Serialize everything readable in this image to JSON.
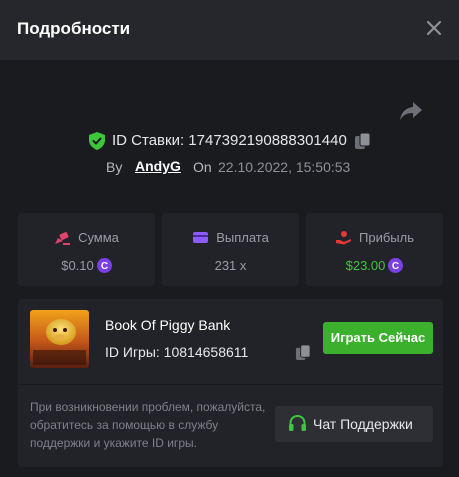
{
  "header": {
    "title": "Подробности",
    "close_icon": "close-icon"
  },
  "bet": {
    "id_label": "ID Ставки: 1747392190888301440",
    "by_label": "By",
    "user": "AndyG",
    "on_label": "On",
    "date": "22.10.2022, 15:50:53"
  },
  "stats": [
    {
      "label": "Сумма",
      "value": "$0.10",
      "icon": "bet-amount-icon",
      "icon_color": "#e0436b",
      "coin": true
    },
    {
      "label": "Выплата",
      "value": "231 x",
      "icon": "wallet-icon",
      "icon_color": "#8b5cf6",
      "coin": false
    },
    {
      "label": "Прибыль",
      "value": "$23.00",
      "icon": "profit-hand-icon",
      "icon_color": "#e53935",
      "coin": true
    }
  ],
  "game": {
    "name": "Book Of Piggy Bank",
    "id_label": "ID Игры: 10814658611",
    "play_label": "Играть Сейчас",
    "thumbnail_text": "BOOK OF PIGGY BANK"
  },
  "support": {
    "help_text": "При возникновении проблем, пожалуйста, обратитесь за помощью в службу поддержки и укажите ID игры.",
    "button_label": "Чат Поддержки"
  },
  "colors": {
    "background": "#1a1b1f",
    "panel": "#222328",
    "header": "#26272c",
    "accent_green": "#3ab02c",
    "profit_green": "#3ec63a",
    "coin_purple": "#7b3fe4"
  }
}
